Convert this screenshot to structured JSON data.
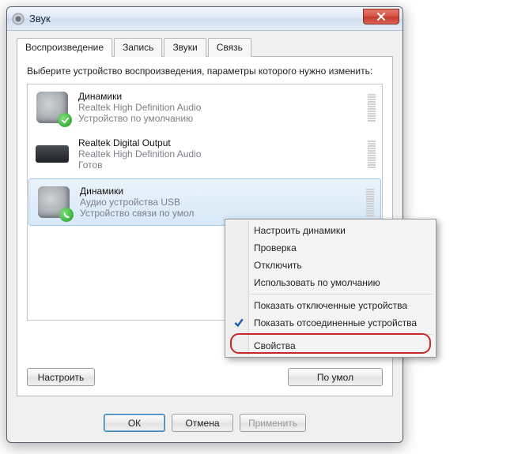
{
  "window": {
    "title": "Звук"
  },
  "tabs": [
    {
      "label": "Воспроизведение",
      "active": true
    },
    {
      "label": "Запись"
    },
    {
      "label": "Звуки"
    },
    {
      "label": "Связь"
    }
  ],
  "instruction": "Выберите устройство воспроизведения, параметры которого нужно изменить:",
  "devices": [
    {
      "name": "Динамики",
      "driver": "Realtek High Definition Audio",
      "status": "Устройство по умолчанию",
      "icon": "speaker",
      "badge": "check",
      "selected": false
    },
    {
      "name": "Realtek Digital Output",
      "driver": "Realtek High Definition Audio",
      "status": "Готов",
      "icon": "amp",
      "badge": "",
      "selected": false
    },
    {
      "name": "Динамики",
      "driver": "Аудио устройства USB",
      "status": "Устройство связи по умол",
      "icon": "speaker",
      "badge": "phone",
      "selected": true
    }
  ],
  "panel_buttons": {
    "configure": "Настроить",
    "set_default": "По умол"
  },
  "dialog_buttons": {
    "ok": "ОК",
    "cancel": "Отмена",
    "apply": "Применить"
  },
  "context_menu": {
    "items": [
      {
        "label": "Настроить динамики",
        "enabled": true
      },
      {
        "label": "Проверка",
        "enabled": true
      },
      {
        "label": "Отключить",
        "enabled": true
      },
      {
        "label": "Использовать по умолчанию",
        "enabled": true
      },
      {
        "sep": true
      },
      {
        "label": "Показать отключенные устройства",
        "enabled": true,
        "checked": false
      },
      {
        "label": "Показать отсоединенные устройства",
        "enabled": true,
        "checked": true
      },
      {
        "sep": true
      },
      {
        "label": "Свойства",
        "enabled": true,
        "highlighted": true
      }
    ]
  }
}
